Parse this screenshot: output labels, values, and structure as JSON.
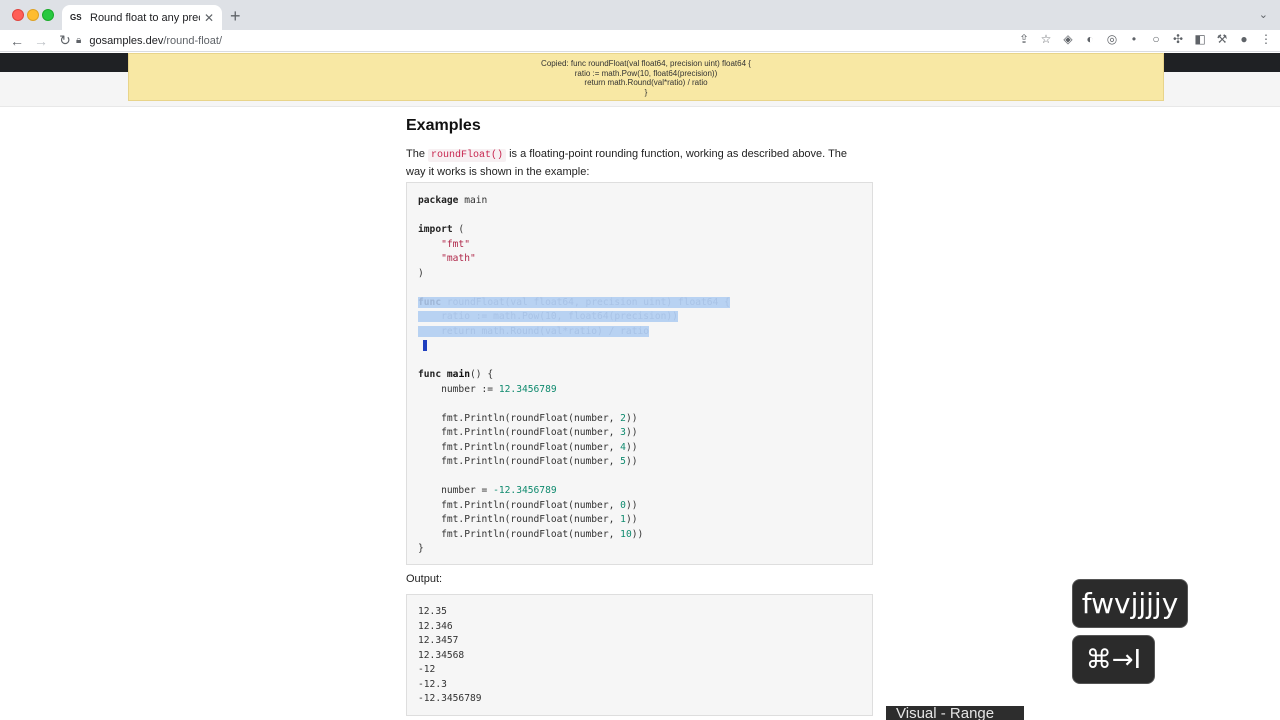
{
  "browser": {
    "tab_title": "Round float to any precision in",
    "favicon_text": "GS",
    "tab_close": "✕",
    "new_tab": "+",
    "url_host": "gosamples.dev",
    "url_path": "/round-float/"
  },
  "toast": {
    "lines": [
      "Copied: func roundFloat(val float64, precision uint) float64 {",
      "ratio := math.Pow(10, float64(precision))",
      "return math.Round(val*ratio) / ratio",
      "}"
    ]
  },
  "article": {
    "heading": "Examples",
    "intro_before": "The ",
    "intro_code": "roundFloat()",
    "intro_after": " is a floating-point rounding function, working as described above. The way it works is shown in the example:",
    "output_label": "Output:"
  },
  "code": {
    "package_kw": "package",
    "package_name": " main",
    "import_kw": "import",
    "import_open": " (",
    "import_fmt": "\"fmt\"",
    "import_math": "\"math\"",
    "import_close": ")",
    "sel_line1_kw": "func",
    "sel_line1_rest": " roundFloat(val float64, precision uint) float64 {",
    "sel_line2": "    ratio := math.Pow(10, float64(precision))",
    "sel_line3": "    return math.Round(val*ratio) / ratio",
    "main_kw": "func",
    "main_name": "main",
    "main_rest": "() {",
    "number_decl": "    number := ",
    "number_val": "12.3456789",
    "println_prefix": "    fmt.Println(roundFloat(number, ",
    "println_suffix": "))",
    "precisions_a": [
      "2",
      "3",
      "4",
      "5"
    ],
    "number_assign": "    number = ",
    "number_neg": "-12.3456789",
    "precisions_b": [
      "0",
      "1",
      "10"
    ],
    "close_brace": "}"
  },
  "output": {
    "lines": [
      "12.35",
      "12.346",
      "12.3457",
      "12.34568",
      "-12",
      "-12.3",
      "-12.3456789"
    ]
  },
  "overlay": {
    "keycast_text": "fwvjjjjy",
    "keycast_combo": "⌘→I",
    "vim_mode": "Visual - Range"
  }
}
